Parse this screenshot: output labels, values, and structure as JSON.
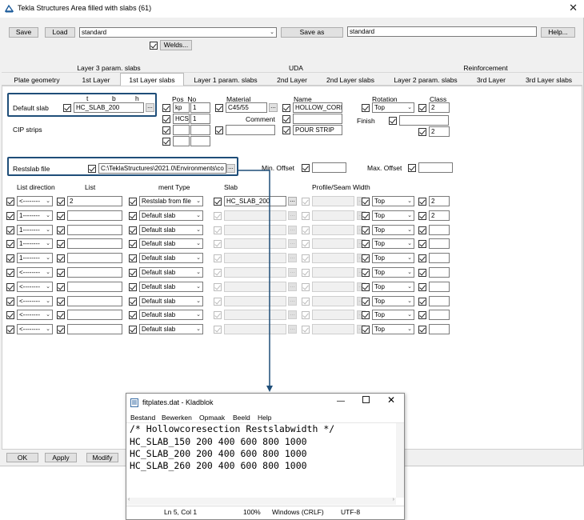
{
  "window": {
    "title": "Tekla Structures  Area filled with slabs (61)"
  },
  "toolbar": {
    "save": "Save",
    "load": "Load",
    "preset": "standard",
    "save_as": "Save as",
    "save_as_name": "standard",
    "help": "Help...",
    "welds": "Welds..."
  },
  "tab_groups": [
    "Layer 3 param. slabs",
    "UDA",
    "Reinforcement"
  ],
  "tabs": [
    "Plate geometry",
    "1st Layer",
    "1st Layer slabs",
    "Layer 1 param. slabs",
    "2nd Layer",
    "2nd Layer slabs",
    "Layer 2 param. slabs",
    "3rd Layer",
    "3rd Layer slabs"
  ],
  "default_slab": {
    "label": "Default slab",
    "col_t": "t",
    "col_b": "b",
    "col_h": "h",
    "value": "HC_SLAB_200",
    "pos_no_label": "Pos_No",
    "pos_prefix_1": "kp",
    "pos_no_1": "1",
    "pos_prefix_2": "HCS",
    "pos_no_2": "1",
    "material_label": "Material",
    "material": "C45/55",
    "comment_label": "Comment",
    "name_label": "Name",
    "name_1": "HOLLOW_CORE",
    "name_2": "",
    "name_3": "POUR STRIP",
    "rotation_label": "Rotation",
    "rotation": "Top",
    "class_label": "Class",
    "class_1": "2",
    "class_2": "2",
    "finish_label": "Finish"
  },
  "cip_strips": {
    "label": "CIP strips"
  },
  "restslab": {
    "label": "Restslab file",
    "path": "C:\\TeklaStructures\\2021.0\\Environments\\co",
    "min_offset_label": "Min. Offset",
    "max_offset_label": "Max. Offset"
  },
  "list_headers": {
    "list_direction": "List direction",
    "list": "List",
    "element_type": "ment Type",
    "slab": "Slab",
    "profile": "Profile/Seam Width"
  },
  "list_rows": [
    {
      "direction": "<--------",
      "list": "2",
      "type": "Restslab from file",
      "slab": "HC_SLAB_200",
      "rotation": "Top",
      "cls": "2"
    },
    {
      "direction": "1--------",
      "list": "",
      "type": "Default slab",
      "slab": "",
      "rotation": "Top",
      "cls": "2"
    },
    {
      "direction": "1--------",
      "list": "",
      "type": "Default slab",
      "slab": "",
      "rotation": "Top",
      "cls": ""
    },
    {
      "direction": "1--------",
      "list": "",
      "type": "Default slab",
      "slab": "",
      "rotation": "Top",
      "cls": ""
    },
    {
      "direction": "1--------",
      "list": "",
      "type": "Default slab",
      "slab": "",
      "rotation": "Top",
      "cls": ""
    },
    {
      "direction": "<--------",
      "list": "",
      "type": "Default slab",
      "slab": "",
      "rotation": "Top",
      "cls": ""
    },
    {
      "direction": "<--------",
      "list": "",
      "type": "Default slab",
      "slab": "",
      "rotation": "Top",
      "cls": ""
    },
    {
      "direction": "<--------",
      "list": "",
      "type": "Default slab",
      "slab": "",
      "rotation": "Top",
      "cls": ""
    },
    {
      "direction": "<--------",
      "list": "",
      "type": "Default slab",
      "slab": "",
      "rotation": "Top",
      "cls": ""
    },
    {
      "direction": "<--------",
      "list": "",
      "type": "Default slab",
      "slab": "",
      "rotation": "Top",
      "cls": ""
    }
  ],
  "bottom_buttons": {
    "ok": "OK",
    "apply": "Apply",
    "modify": "Modify"
  },
  "notepad": {
    "title": "fitplates.dat - Kladblok",
    "menu": [
      "Bestand",
      "Bewerken",
      "Opmaak",
      "Beeld",
      "Help"
    ],
    "lines": [
      "/* Hollowcoresection Restslabwidth */",
      "HC_SLAB_150 200 400 600 800 1000",
      "HC_SLAB_200 200 400 600 800 1000",
      "HC_SLAB_260 200 400 600 800 1000"
    ],
    "status": {
      "position": "Ln 5, Col 1",
      "zoom": "100%",
      "eol": "Windows (CRLF)",
      "encoding": "UTF-8"
    }
  },
  "colors": {
    "highlight": "#1f4e79",
    "window_bg": "#f0f0f0"
  }
}
